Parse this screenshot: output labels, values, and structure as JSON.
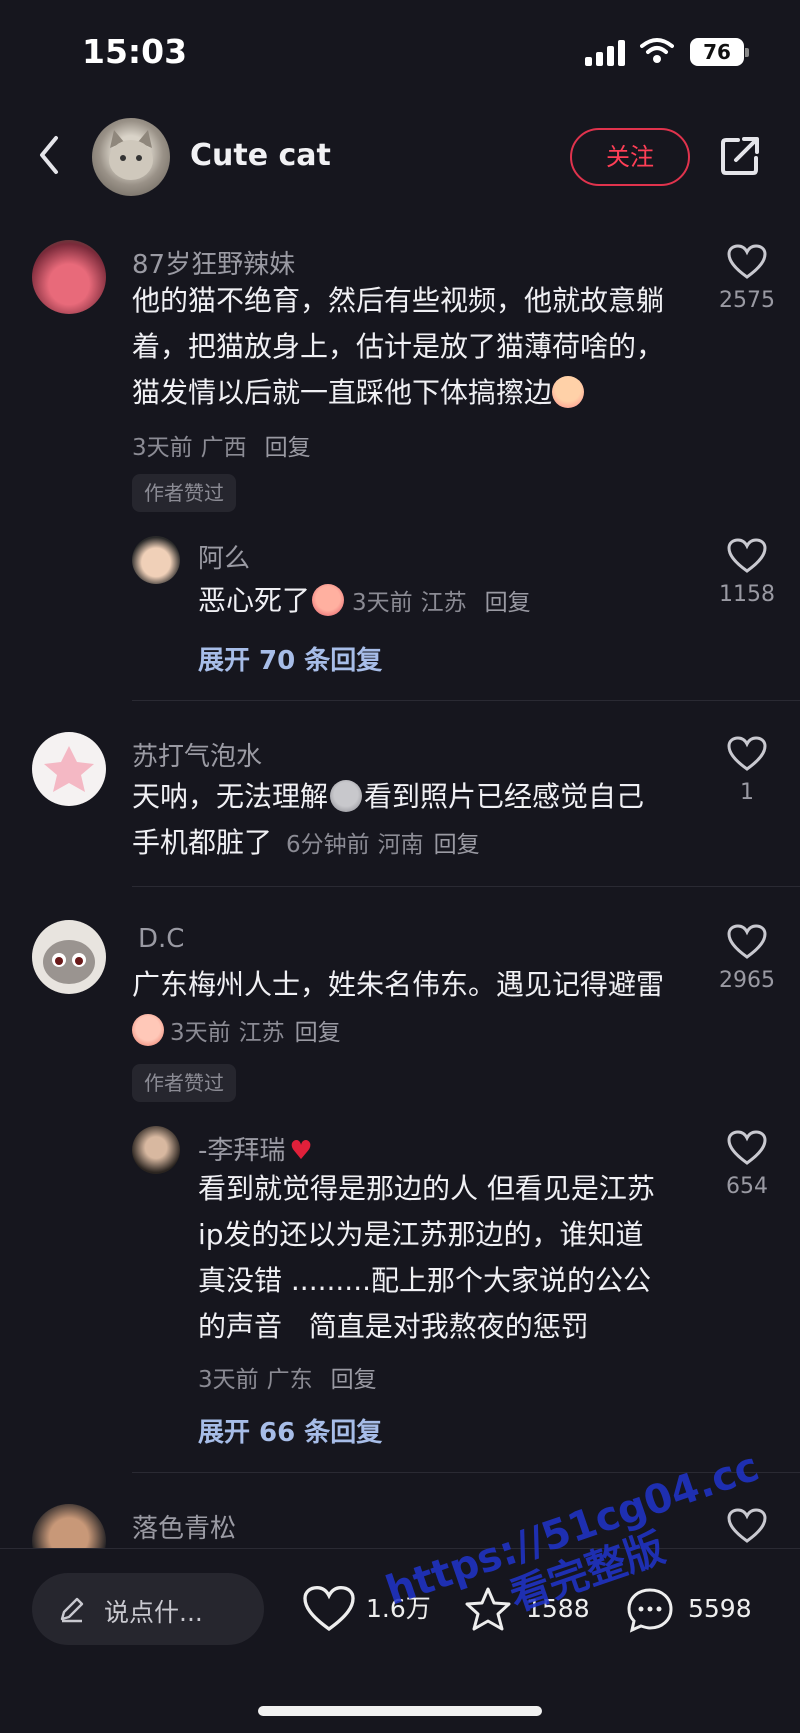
{
  "status_bar": {
    "time": "15:03",
    "battery": "76"
  },
  "header": {
    "title": "Cute cat",
    "follow_label": "关注"
  },
  "comments": [
    {
      "name": "87岁狂野辣妹",
      "text": [
        "他的猫不绝育，然后有些视频，他就故意躺",
        "着，把猫放身上，估计是放了猫薄荷啥的，",
        "猫发情以后就一直踩他下体搞擦边"
      ],
      "time": "3天前",
      "region": "广西",
      "reply": "回复",
      "likes": "2575",
      "liked_label": "作者赞过",
      "sub": {
        "name": "阿么",
        "text": "恶心死了",
        "time": "3天前",
        "region": "江苏",
        "reply": "回复",
        "likes": "1158"
      },
      "expand": "展开 70 条回复"
    },
    {
      "name": "苏打气泡水",
      "text": [
        "天呐，无法理解",
        "看到照片已经感觉自己",
        "手机都脏了"
      ],
      "time": "6分钟前",
      "region": "河南",
      "reply": "回复",
      "likes": "1"
    },
    {
      "name": "D.C",
      "text": [
        "广东梅州人士，姓朱名伟东。遇见记得避雷"
      ],
      "time": "3天前",
      "region": "江苏",
      "reply": "回复",
      "likes": "2965",
      "liked_label": "作者赞过",
      "sub": {
        "name": "-李拜瑞",
        "text": [
          "看到就觉得是那边的人 但看见是江苏",
          "ip发的还以为是江苏那边的，谁知道",
          "真没错 .........配上那个大家说的公公",
          "的声音   简直是对我熬夜的惩罚"
        ],
        "time": "3天前",
        "region": "广东",
        "reply": "回复",
        "likes": "654"
      },
      "expand": "展开 66 条回复"
    },
    {
      "name": "落色青松"
    }
  ],
  "bottom_bar": {
    "placeholder": "说点什...",
    "likes": "1.6万",
    "favorites": "1588",
    "comments": "5598"
  },
  "watermark": {
    "line1": "https://51cg04.cc",
    "line2": "看完整版"
  },
  "colors": {
    "background": "#16161e",
    "accent": "#e0334d",
    "link": "#a7bde8"
  }
}
